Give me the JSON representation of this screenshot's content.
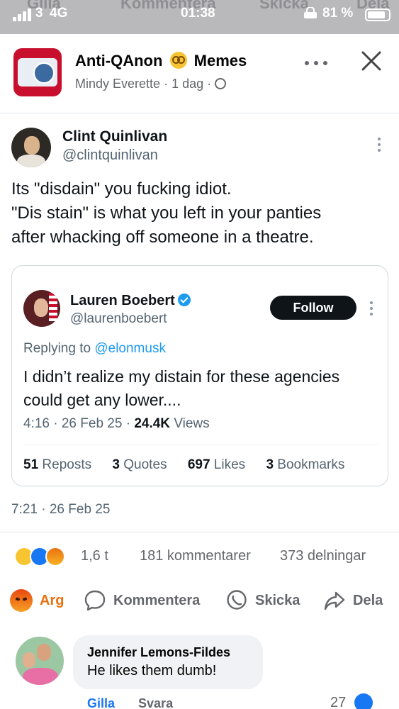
{
  "status_bar": {
    "carrier": "3",
    "network": "4G",
    "time": "01:38",
    "battery": "81 %",
    "ghost_labels": [
      "Gilla",
      "Kommentera",
      "Skicka",
      "Dela"
    ]
  },
  "header": {
    "page_name": "Anti-QAnon",
    "page_name_suffix": "Memes",
    "author": "Mindy Everette",
    "time": "1 dag",
    "separator": "·"
  },
  "tweet": {
    "author_name": "Clint Quinlivan",
    "author_handle": "@clintquinlivan",
    "body_lines": [
      "Its \"disdain\" you fucking idiot.",
      "\"Dis stain\" is what you left in your panties",
      "after whacking off someone in a theatre."
    ],
    "timestamp": "7:21 · 26 Feb 25",
    "quote": {
      "author_name": "Lauren Boebert",
      "author_handle": "@laurenboebert",
      "follow_label": "Follow",
      "replying_prefix": "Replying to",
      "replying_to": "@elonmusk",
      "body_lines": [
        "I didn’t realize my distain for these agencies",
        "could get any lower...."
      ],
      "meta_time": "4:16 · 26 Feb 25 ·",
      "views_count": "24.4K",
      "views_label": "Views",
      "reposts_count": "51",
      "reposts_label": "Reposts",
      "quotes_count": "3",
      "quotes_label": "Quotes",
      "likes_count": "697",
      "likes_label": "Likes",
      "bookmarks_count": "3",
      "bookmarks_label": "Bookmarks"
    }
  },
  "reactions": {
    "count": "1,6 t",
    "comments": "181 kommentarer",
    "shares": "373 delningar"
  },
  "actions": {
    "react": "Arg",
    "comment": "Kommentera",
    "send": "Skicka",
    "share": "Dela"
  },
  "comment": {
    "author": "Jennifer Lemons-Fildes",
    "text": "He likes them dumb!",
    "like_label": "Gilla",
    "reply_label": "Svara",
    "like_count": "27"
  },
  "colors": {
    "accent": "#1877f2",
    "angry": "#e9710f",
    "twitter_blue": "#1d9bf0"
  }
}
